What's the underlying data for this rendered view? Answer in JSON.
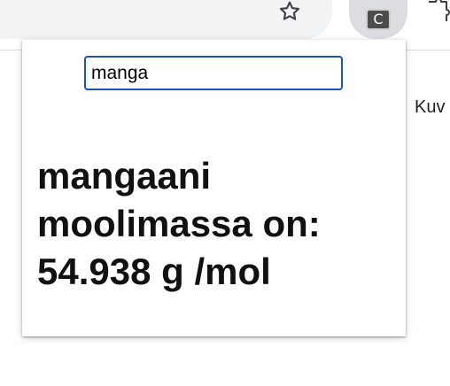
{
  "browser": {
    "bookmark_icon": "star-icon",
    "extension_icon_label": "C",
    "extensions_menu_icon": "puzzle-icon"
  },
  "background_page": {
    "partial_text": "Kuv"
  },
  "popup": {
    "search": {
      "value": "manga"
    },
    "result_line1": "mangaani",
    "result_line2": "moolimassa on:",
    "result_line3": "54.938 g /mol"
  }
}
